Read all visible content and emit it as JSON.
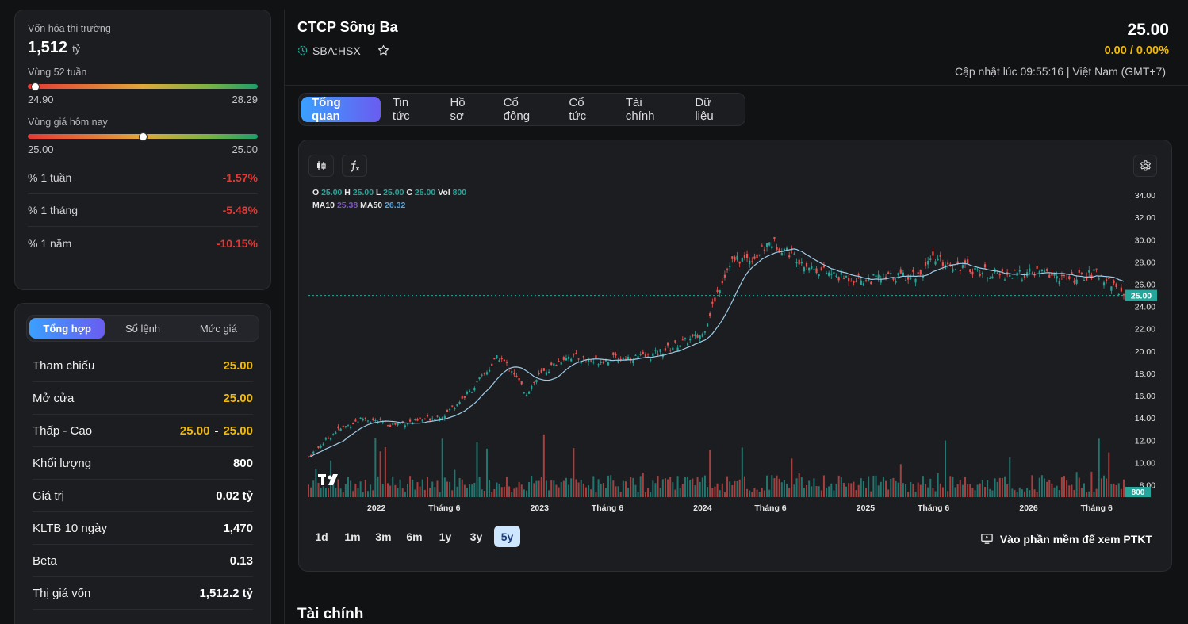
{
  "market_cap": {
    "label": "Vốn hóa thị trường",
    "value": "1,512",
    "unit": "tỷ"
  },
  "range_52w": {
    "label": "Vùng 52 tuần",
    "low": "24.90",
    "high": "28.29",
    "position": 0.03
  },
  "range_today": {
    "label": "Vùng giá hôm nay",
    "low": "25.00",
    "high": "25.00",
    "position": 0.5
  },
  "performance": [
    {
      "label": "% 1 tuần",
      "value": "-1.57%"
    },
    {
      "label": "% 1 tháng",
      "value": "-5.48%"
    },
    {
      "label": "% 1 năm",
      "value": "-10.15%"
    }
  ],
  "summary_tabs": [
    "Tổng hợp",
    "Sổ lệnh",
    "Mức giá"
  ],
  "stats": {
    "ref": {
      "label": "Tham chiếu",
      "value": "25.00"
    },
    "open": {
      "label": "Mở cửa",
      "value": "25.00"
    },
    "lowhigh": {
      "label": "Thấp - Cao",
      "low": "25.00",
      "sep": "-",
      "high": "25.00"
    },
    "volume": {
      "label": "Khối lượng",
      "value": "800"
    },
    "value": {
      "label": "Giá trị",
      "value": "0.02 tỷ"
    },
    "avg10": {
      "label": "KLTB 10 ngày",
      "value": "1,470"
    },
    "beta": {
      "label": "Beta",
      "value": "0.13"
    },
    "book": {
      "label": "Thị giá vốn",
      "value": "1,512.2 tỷ"
    }
  },
  "header": {
    "company": "CTCP Sông Ba",
    "ticker": "SBA:HSX",
    "price": "25.00",
    "change": "0.00 / 0.00%",
    "updated": "Cập nhật lúc 09:55:16 | Việt Nam (GMT+7)"
  },
  "tabs": [
    "Tổng quan",
    "Tin tức",
    "Hồ sơ",
    "Cổ đông",
    "Cổ tức",
    "Tài chính",
    "Dữ liệu"
  ],
  "chart_legend": {
    "o_label": "O",
    "o": "25.00",
    "h_label": "H",
    "h": "25.00",
    "l_label": "L",
    "l": "25.00",
    "c_label": "C",
    "c": "25.00",
    "vol_label": "Vol",
    "vol": "800",
    "ma10_label": "MA10",
    "ma10": "25.38",
    "ma50_label": "MA50",
    "ma50": "26.32"
  },
  "ranges": [
    "1d",
    "1m",
    "3m",
    "6m",
    "1y",
    "3y",
    "5y"
  ],
  "ptkt_label": "Vào phần mềm để xem PTKT",
  "section_title": "Tài chính",
  "colors": {
    "up": "#26a69a",
    "down": "#ef5350",
    "accent": "#f0b90b",
    "ma10": "#7e57c2",
    "ma50": "#9ecbe6"
  },
  "chart_data": {
    "type": "line",
    "series": [
      {
        "name": "Giá",
        "x": [
          "2021-08",
          "2021-10",
          "2021-12",
          "2022-02",
          "2022-04",
          "2022-06",
          "2022-08",
          "2022-10",
          "2022-11",
          "2022-12",
          "2023-01",
          "2023-03",
          "2023-05",
          "2023-07",
          "2023-09",
          "2023-11",
          "2024-01",
          "2024-02",
          "2024-03",
          "2024-05",
          "2024-06",
          "2024-07",
          "2024-09",
          "2024-11",
          "2025-01",
          "2025-03",
          "2025-05",
          "2025-06",
          "2025-08",
          "2025-10",
          "2025-12",
          "2026-02",
          "2026-04",
          "2026-06",
          "2026-07",
          "2026-08"
        ],
        "values": [
          10.5,
          12.8,
          14.0,
          13.4,
          13.7,
          14.3,
          16.5,
          19.5,
          18.3,
          16.2,
          17.8,
          19.6,
          19.1,
          19.4,
          19.5,
          20.5,
          21.5,
          25.0,
          28.0,
          28.5,
          29.8,
          29.2,
          27.5,
          26.7,
          26.4,
          26.7,
          26.9,
          28.2,
          27.6,
          27.0,
          26.8,
          27.1,
          26.4,
          27.0,
          26.2,
          25.0
        ]
      },
      {
        "name": "MA10",
        "value": 25.38
      },
      {
        "name": "MA50",
        "value": 26.32
      }
    ],
    "volume_last": 800,
    "y_ticks": [
      "34.00",
      "32.00",
      "30.00",
      "28.00",
      "26.00",
      "24.00",
      "22.00",
      "20.00",
      "18.00",
      "16.00",
      "14.00",
      "12.00",
      "10.00",
      "8.00"
    ],
    "x_ticks": [
      "2022",
      "Tháng 6",
      "2023",
      "Tháng 6",
      "2024",
      "Tháng 6",
      "2025",
      "Tháng 6",
      "2026",
      "Tháng 6"
    ],
    "ylim": [
      6.9,
      35
    ],
    "last_price_label": "25.00",
    "last_volume_label": "800"
  }
}
